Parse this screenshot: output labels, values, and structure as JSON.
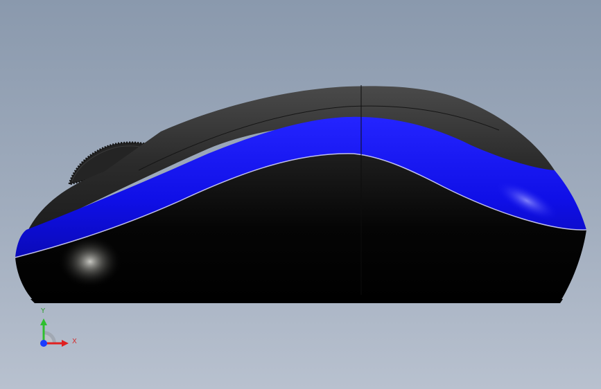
{
  "viewport": {
    "background_top": "#8a99ad",
    "background_bottom": "#b8c1cf"
  },
  "model": {
    "part": "computer-mouse",
    "view": "side",
    "colors": {
      "shell": "#000000",
      "top_cover": "#2a2a2a",
      "stripe": "#1010f0",
      "scroll_wheel": "#222222"
    }
  },
  "triad": {
    "y_label": "Y",
    "x_label": "X",
    "colors": {
      "y": "#2fbf2f",
      "x": "#e02020",
      "z": "#1a3cff"
    }
  }
}
